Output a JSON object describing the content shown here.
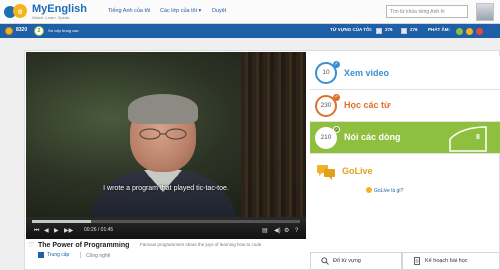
{
  "brand": {
    "name": "MyEnglish",
    "tagline": "Watch. Learn. Speak."
  },
  "nav": {
    "items": [
      {
        "label": "Tiếng Anh của tôi"
      },
      {
        "label": "Các lớp của tôi ▾"
      },
      {
        "label": "Duyệt"
      }
    ],
    "search_placeholder": "Tìm từ khóa tiếng Anh hi"
  },
  "stats": {
    "points": "8320",
    "level": "2",
    "level_label": "Sơ cấp trung cao",
    "vocab_label": "TỪ VỰNG CỦA TÔI:",
    "vocab_a": "276",
    "vocab_b": "276",
    "pronounce_label": "PHÁT ÂM:"
  },
  "video": {
    "subtitle": "I wrote a program that played tic-tac-toe.",
    "time": "00:26 / 01:45",
    "progress": 0.22,
    "title": "The Power of Programming",
    "level_tag": "Trung cấp",
    "topic_tag": "Công nghệ",
    "description": "Famous programmers share the joys of learning how to code."
  },
  "steps": [
    {
      "count": "10",
      "label": "Xem video",
      "color": "#3a8fd0",
      "state": "done"
    },
    {
      "count": "230",
      "label": "Học các từ",
      "color": "#e0702a",
      "state": "done"
    },
    {
      "count": "210",
      "label": "Nói các dòng",
      "color": "#ffffff",
      "state": "active",
      "badge": "8"
    }
  ],
  "golive": {
    "label": "GoLive",
    "help": "GoLive là gì?"
  },
  "bottom": {
    "vocab_button": "Đổ từ vựng",
    "plan_button": "Kế hoạch bài học"
  },
  "colors": {
    "brand_blue": "#1e5fa8",
    "active_green": "#8fbf3e",
    "golive_orange": "#e1a21a"
  }
}
